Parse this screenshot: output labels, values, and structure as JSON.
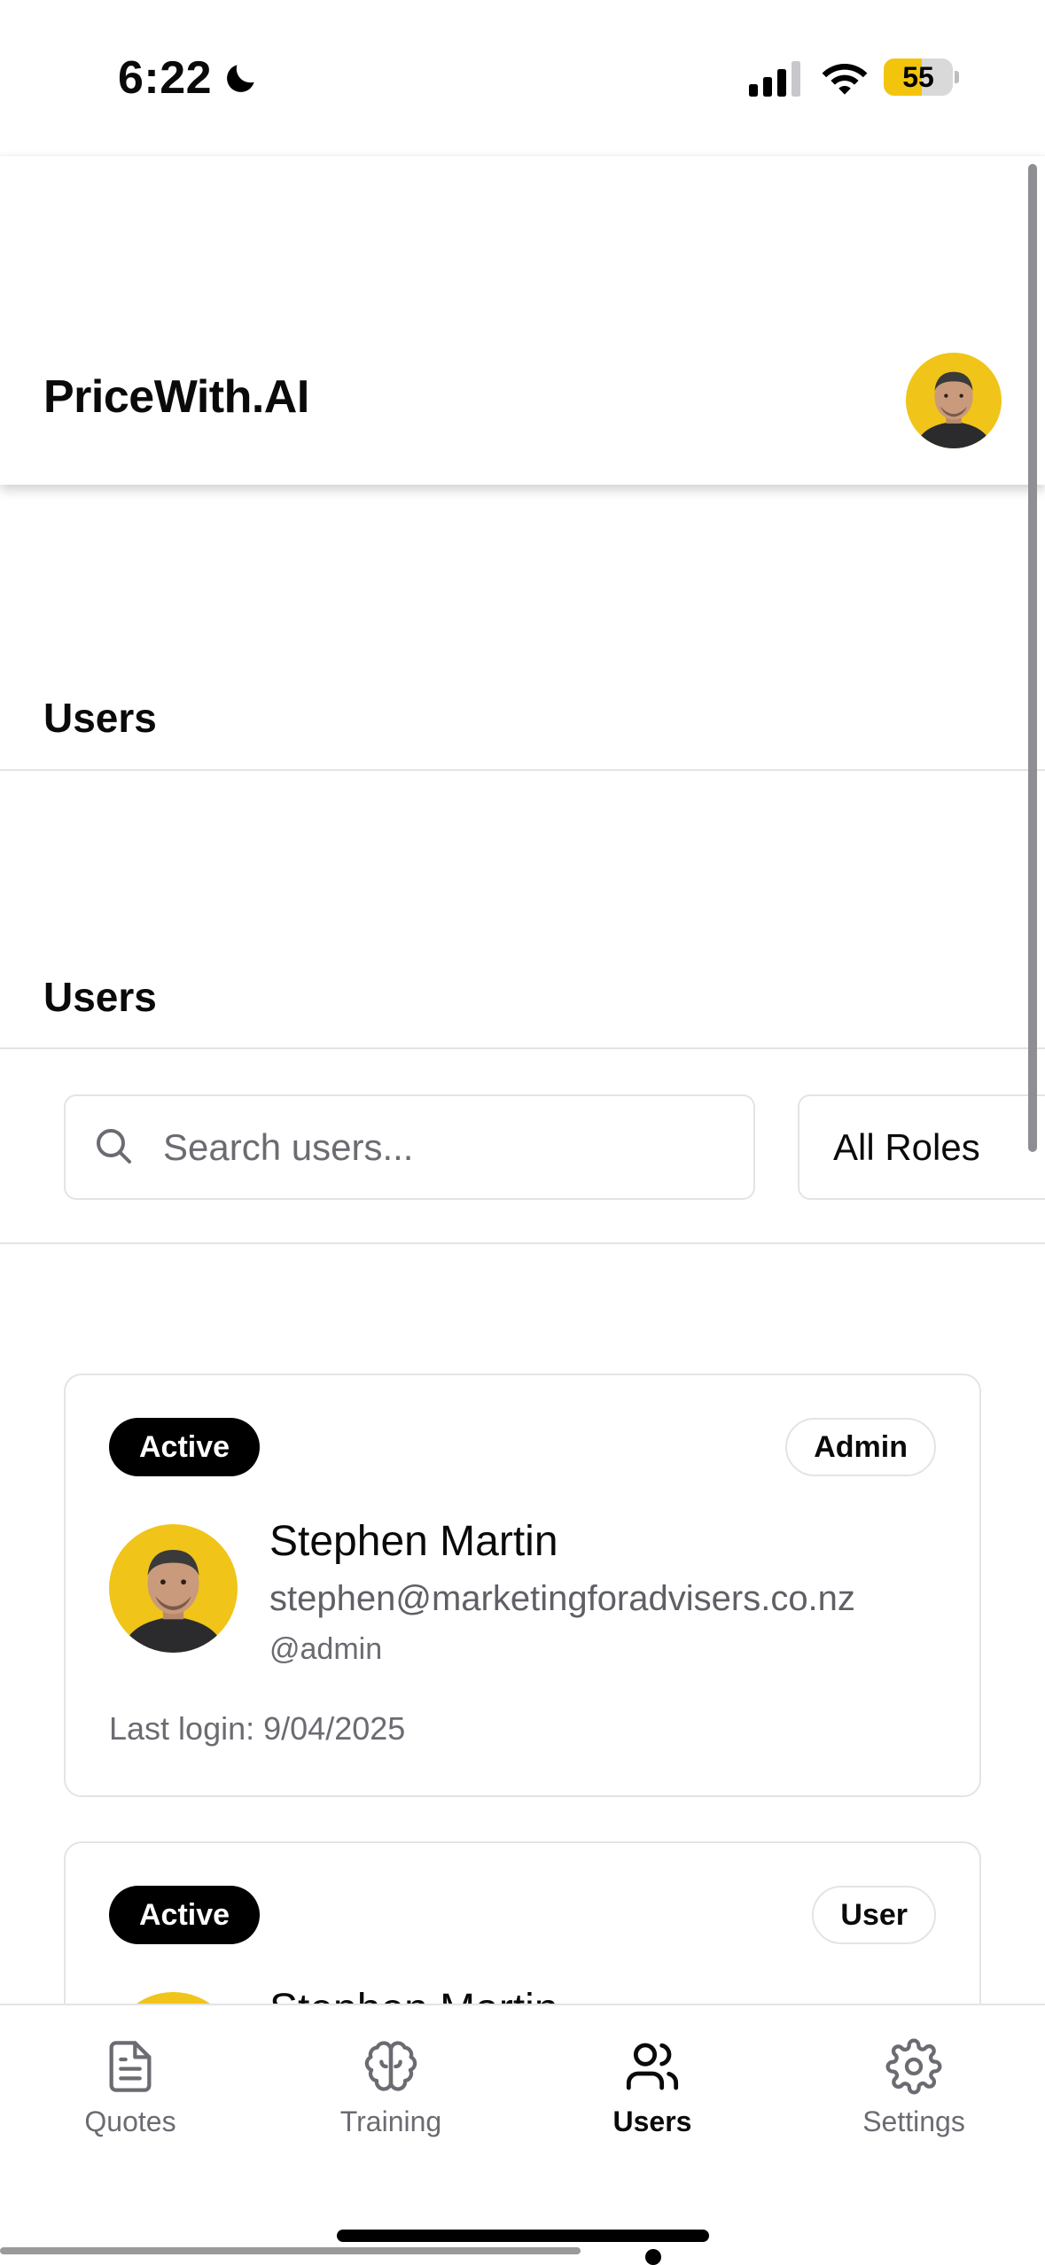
{
  "status_bar": {
    "time": "6:22",
    "battery": "55",
    "battery_level_percent": 55,
    "icons": [
      "moon-icon",
      "signal-icon",
      "wifi-icon",
      "battery-icon"
    ]
  },
  "header": {
    "brand": "PriceWith.AI",
    "avatar_icon": "user-avatar"
  },
  "page": {
    "title": "Users",
    "section_title": "Users"
  },
  "filters": {
    "search_placeholder": "Search users...",
    "search_value": "",
    "role_select": "All Roles"
  },
  "users": [
    {
      "status": "Active",
      "role": "Admin",
      "name": "Stephen Martin",
      "email": "stephen@marketingforadvisers.co.nz",
      "handle": "@admin",
      "last_login_label": "Last login:",
      "last_login_value": "9/04/2025"
    },
    {
      "status": "Active",
      "role": "User",
      "name": "Stephen Martin"
    }
  ],
  "nav": {
    "items": [
      {
        "label": "Quotes",
        "icon": "document-icon"
      },
      {
        "label": "Training",
        "icon": "brain-icon"
      },
      {
        "label": "Users",
        "icon": "users-icon"
      },
      {
        "label": "Settings",
        "icon": "gear-icon"
      }
    ],
    "active": "Users"
  },
  "colors": {
    "accent_yellow": "#f2c40c",
    "badge_black": "#000000",
    "border": "#e4e4e7",
    "muted_text": "#6b6b72"
  }
}
